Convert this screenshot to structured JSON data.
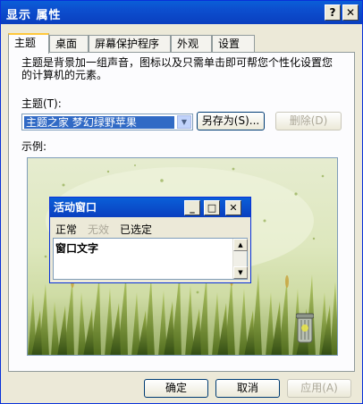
{
  "window": {
    "title": "显示 属性",
    "help_button": "?",
    "close_button": "✕"
  },
  "tabs": [
    {
      "label": "主题"
    },
    {
      "label": "桌面"
    },
    {
      "label": "屏幕保护程序"
    },
    {
      "label": "外观"
    },
    {
      "label": "设置"
    }
  ],
  "themes": {
    "description": "主题是背景加一组声音，图标以及只需单击即可帮您个性化设置您的计算机的元素。",
    "theme_label": "主题(T):",
    "selected_theme": "主题之家 梦幻绿野苹果",
    "save_as_label": "另存为(S)...",
    "delete_label": "删除(D)",
    "sample_label": "示例:"
  },
  "preview": {
    "window_title": "活动窗口",
    "menu_normal": "正常",
    "menu_disabled": "无效",
    "menu_selected": "已选定",
    "window_text": "窗口文字"
  },
  "footer": {
    "ok_label": "确定",
    "cancel_label": "取消",
    "apply_label": "应用(A)"
  },
  "colors": {
    "title_bar": "#0a4fcf",
    "dialog_face": "#ece9d8",
    "selection": "#316ac5",
    "tab_highlight": "#ffc83c"
  }
}
